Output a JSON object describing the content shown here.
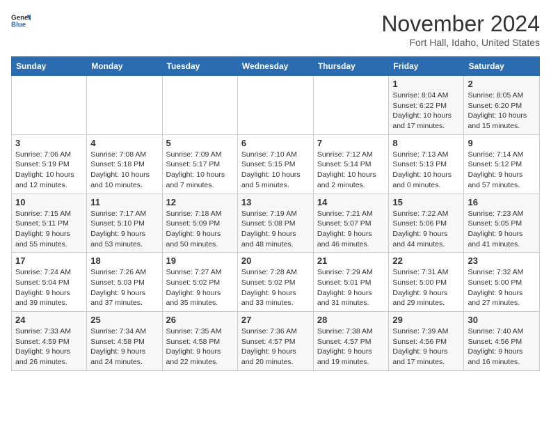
{
  "header": {
    "logo_line1": "General",
    "logo_line2": "Blue",
    "month_title": "November 2024",
    "subtitle": "Fort Hall, Idaho, United States"
  },
  "days_of_week": [
    "Sunday",
    "Monday",
    "Tuesday",
    "Wednesday",
    "Thursday",
    "Friday",
    "Saturday"
  ],
  "weeks": [
    [
      {
        "day": "",
        "info": ""
      },
      {
        "day": "",
        "info": ""
      },
      {
        "day": "",
        "info": ""
      },
      {
        "day": "",
        "info": ""
      },
      {
        "day": "",
        "info": ""
      },
      {
        "day": "1",
        "info": "Sunrise: 8:04 AM\nSunset: 6:22 PM\nDaylight: 10 hours and 17 minutes."
      },
      {
        "day": "2",
        "info": "Sunrise: 8:05 AM\nSunset: 6:20 PM\nDaylight: 10 hours and 15 minutes."
      }
    ],
    [
      {
        "day": "3",
        "info": "Sunrise: 7:06 AM\nSunset: 5:19 PM\nDaylight: 10 hours and 12 minutes."
      },
      {
        "day": "4",
        "info": "Sunrise: 7:08 AM\nSunset: 5:18 PM\nDaylight: 10 hours and 10 minutes."
      },
      {
        "day": "5",
        "info": "Sunrise: 7:09 AM\nSunset: 5:17 PM\nDaylight: 10 hours and 7 minutes."
      },
      {
        "day": "6",
        "info": "Sunrise: 7:10 AM\nSunset: 5:15 PM\nDaylight: 10 hours and 5 minutes."
      },
      {
        "day": "7",
        "info": "Sunrise: 7:12 AM\nSunset: 5:14 PM\nDaylight: 10 hours and 2 minutes."
      },
      {
        "day": "8",
        "info": "Sunrise: 7:13 AM\nSunset: 5:13 PM\nDaylight: 10 hours and 0 minutes."
      },
      {
        "day": "9",
        "info": "Sunrise: 7:14 AM\nSunset: 5:12 PM\nDaylight: 9 hours and 57 minutes."
      }
    ],
    [
      {
        "day": "10",
        "info": "Sunrise: 7:15 AM\nSunset: 5:11 PM\nDaylight: 9 hours and 55 minutes."
      },
      {
        "day": "11",
        "info": "Sunrise: 7:17 AM\nSunset: 5:10 PM\nDaylight: 9 hours and 53 minutes."
      },
      {
        "day": "12",
        "info": "Sunrise: 7:18 AM\nSunset: 5:09 PM\nDaylight: 9 hours and 50 minutes."
      },
      {
        "day": "13",
        "info": "Sunrise: 7:19 AM\nSunset: 5:08 PM\nDaylight: 9 hours and 48 minutes."
      },
      {
        "day": "14",
        "info": "Sunrise: 7:21 AM\nSunset: 5:07 PM\nDaylight: 9 hours and 46 minutes."
      },
      {
        "day": "15",
        "info": "Sunrise: 7:22 AM\nSunset: 5:06 PM\nDaylight: 9 hours and 44 minutes."
      },
      {
        "day": "16",
        "info": "Sunrise: 7:23 AM\nSunset: 5:05 PM\nDaylight: 9 hours and 41 minutes."
      }
    ],
    [
      {
        "day": "17",
        "info": "Sunrise: 7:24 AM\nSunset: 5:04 PM\nDaylight: 9 hours and 39 minutes."
      },
      {
        "day": "18",
        "info": "Sunrise: 7:26 AM\nSunset: 5:03 PM\nDaylight: 9 hours and 37 minutes."
      },
      {
        "day": "19",
        "info": "Sunrise: 7:27 AM\nSunset: 5:02 PM\nDaylight: 9 hours and 35 minutes."
      },
      {
        "day": "20",
        "info": "Sunrise: 7:28 AM\nSunset: 5:02 PM\nDaylight: 9 hours and 33 minutes."
      },
      {
        "day": "21",
        "info": "Sunrise: 7:29 AM\nSunset: 5:01 PM\nDaylight: 9 hours and 31 minutes."
      },
      {
        "day": "22",
        "info": "Sunrise: 7:31 AM\nSunset: 5:00 PM\nDaylight: 9 hours and 29 minutes."
      },
      {
        "day": "23",
        "info": "Sunrise: 7:32 AM\nSunset: 5:00 PM\nDaylight: 9 hours and 27 minutes."
      }
    ],
    [
      {
        "day": "24",
        "info": "Sunrise: 7:33 AM\nSunset: 4:59 PM\nDaylight: 9 hours and 26 minutes."
      },
      {
        "day": "25",
        "info": "Sunrise: 7:34 AM\nSunset: 4:58 PM\nDaylight: 9 hours and 24 minutes."
      },
      {
        "day": "26",
        "info": "Sunrise: 7:35 AM\nSunset: 4:58 PM\nDaylight: 9 hours and 22 minutes."
      },
      {
        "day": "27",
        "info": "Sunrise: 7:36 AM\nSunset: 4:57 PM\nDaylight: 9 hours and 20 minutes."
      },
      {
        "day": "28",
        "info": "Sunrise: 7:38 AM\nSunset: 4:57 PM\nDaylight: 9 hours and 19 minutes."
      },
      {
        "day": "29",
        "info": "Sunrise: 7:39 AM\nSunset: 4:56 PM\nDaylight: 9 hours and 17 minutes."
      },
      {
        "day": "30",
        "info": "Sunrise: 7:40 AM\nSunset: 4:56 PM\nDaylight: 9 hours and 16 minutes."
      }
    ]
  ]
}
